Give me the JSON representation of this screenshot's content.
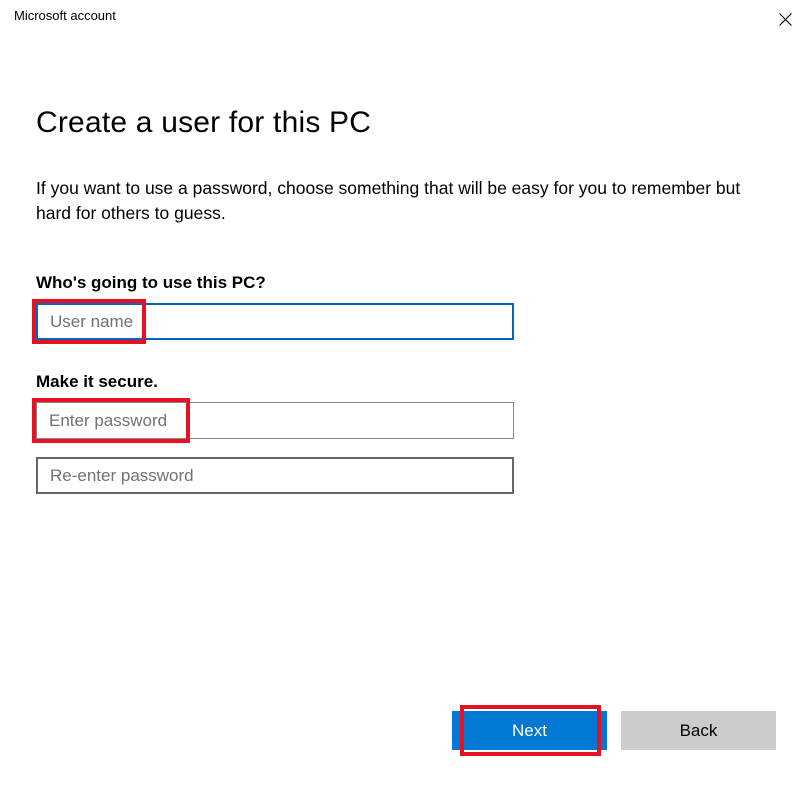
{
  "window": {
    "title": "Microsoft account"
  },
  "main": {
    "heading": "Create a user for this PC",
    "description": "If you want to use a password, choose something that will be easy for you to remember but hard for others to guess.",
    "section_user_label": "Who's going to use this PC?",
    "username_placeholder": "User name",
    "section_secure_label": "Make it secure.",
    "password_placeholder": "Enter password",
    "reenter_placeholder": "Re-enter password"
  },
  "buttons": {
    "next": "Next",
    "back": "Back"
  }
}
